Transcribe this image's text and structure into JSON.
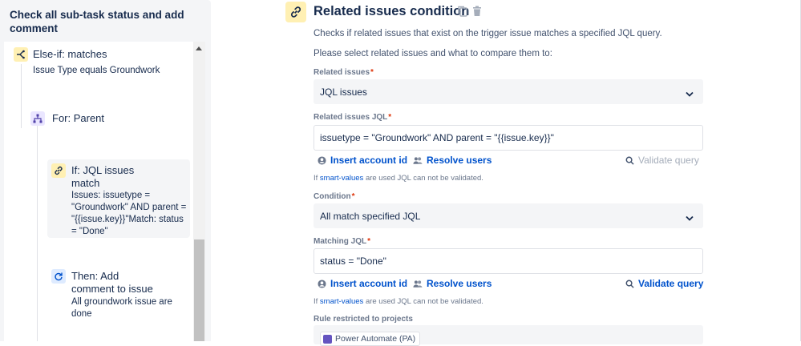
{
  "sidebar": {
    "title": "Check all sub-task status and add comment",
    "nodes": {
      "elseif": {
        "title": "Else-if: matches",
        "subtitle": "Issue Type equals Groundwork"
      },
      "for": {
        "title": "For: Parent"
      },
      "if": {
        "title_line1": "If: JQL issues",
        "title_line2": "match",
        "details": "Issues: issuetype = \"Groundwork\" AND parent = \"{{issue.key}}\"Match: status = \"Done\""
      },
      "then": {
        "title_line1": "Then: Add",
        "title_line2": "comment to issue",
        "details": "All groundwork issue are done"
      }
    }
  },
  "main": {
    "title": "Related issues condition",
    "description": "Checks if related issues that exist on the trigger issue matches a specified JQL query.",
    "instruction": "Please select related issues and what to compare them to:",
    "related_issues": {
      "label": "Related issues",
      "value": "JQL issues"
    },
    "related_jql": {
      "label": "Related issues JQL",
      "value": "issuetype = \"Groundwork\" AND parent = \"{{issue.key}}\"",
      "insert_account": "Insert account id",
      "resolve_users": "Resolve users",
      "validate": "Validate query",
      "note_prefix": "If",
      "note_link": "smart-values",
      "note_suffix": "are used JQL can not be validated."
    },
    "condition": {
      "label": "Condition",
      "value": "All match specified JQL"
    },
    "matching_jql": {
      "label": "Matching JQL",
      "value": "status = \"Done\"",
      "insert_account": "Insert account id",
      "resolve_users": "Resolve users",
      "validate": "Validate query",
      "note_prefix": "If",
      "note_link": "smart-values",
      "note_suffix": "are used JQL can not be validated."
    },
    "restricted": {
      "label": "Rule restricted to projects",
      "project": "Power Automate (PA)"
    }
  },
  "colors": {
    "link": "#0052cc",
    "required": "#de350b",
    "condition_icon_bg": "#fff0b3",
    "branch_icon_bg": "#eae6ff",
    "action_icon_bg": "#deebff"
  },
  "icons": {
    "elseif": "branch-condition-icon",
    "for": "branch-icon",
    "if": "link-icon",
    "then": "refresh-icon",
    "header": "link-icon",
    "copy": "copy-icon",
    "delete": "trash-icon",
    "account": "user-circle-icon",
    "users": "users-icon",
    "validate": "search-icon"
  }
}
